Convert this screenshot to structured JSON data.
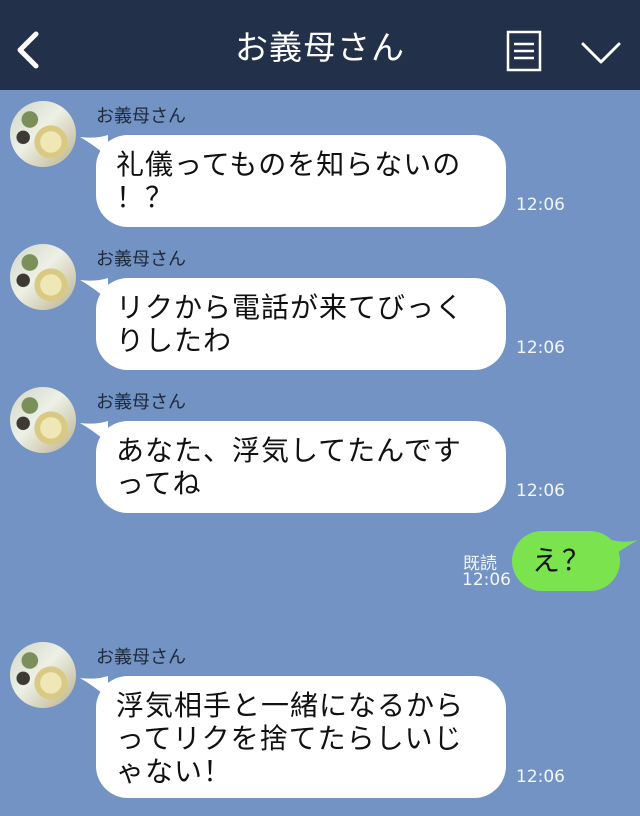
{
  "header": {
    "title": "お義母さん",
    "back_icon": "chevron-left-icon",
    "menu_icon": "document-menu-icon",
    "dropdown_icon": "chevron-down-icon"
  },
  "colors": {
    "background": "#7293c3",
    "header": "#23304a",
    "incoming_bubble": "#ffffff",
    "outgoing_bubble": "#7be34d"
  },
  "messages": [
    {
      "sender": "お義母さん",
      "text": "礼儀ってものを知らないの\n！？",
      "time": "12:06"
    },
    {
      "sender": "お義母さん",
      "text": "リクから電話が来てびっく\nりしたわ",
      "time": "12:06"
    },
    {
      "sender": "お義母さん",
      "text": "あなた、浮気してたんです\nってね",
      "time": "12:06"
    },
    {
      "sender": "me",
      "text": "え？",
      "read": "既読",
      "time": "12:06"
    },
    {
      "sender": "お義母さん",
      "text": "浮気相手と一緒になるから\nってリクを捨てたらしいじ\nゃない！",
      "time": "12:06"
    }
  ]
}
